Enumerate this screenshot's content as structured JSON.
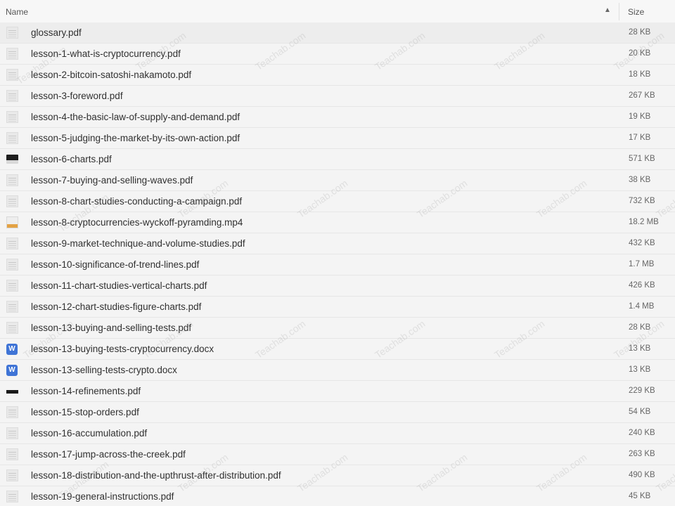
{
  "header": {
    "name_label": "Name",
    "sort_icon": "▲",
    "size_label": "Size"
  },
  "files": [
    {
      "name": "glossary.pdf",
      "size": "28 KB",
      "icon": "doc-thumb"
    },
    {
      "name": "lesson-1-what-is-cryptocurrency.pdf",
      "size": "20 KB",
      "icon": "doc-thumb"
    },
    {
      "name": "lesson-2-bitcoin-satoshi-nakamoto.pdf",
      "size": "18 KB",
      "icon": "doc-thumb"
    },
    {
      "name": "lesson-3-foreword.pdf",
      "size": "267 KB",
      "icon": "doc-thumb"
    },
    {
      "name": "lesson-4-the-basic-law-of-supply-and-demand.pdf",
      "size": "19 KB",
      "icon": "doc-thumb"
    },
    {
      "name": "lesson-5-judging-the-market-by-its-own-action.pdf",
      "size": "17 KB",
      "icon": "doc-thumb"
    },
    {
      "name": "lesson-6-charts.pdf",
      "size": "571 KB",
      "icon": "dark-thumb"
    },
    {
      "name": "lesson-7-buying-and-selling-waves.pdf",
      "size": "38 KB",
      "icon": "doc-thumb"
    },
    {
      "name": "lesson-8-chart-studies-conducting-a-campaign.pdf",
      "size": "732 KB",
      "icon": "doc-thumb"
    },
    {
      "name": "lesson-8-cryptocurrencies-wyckoff-pyramding.mp4",
      "size": "18.2 MB",
      "icon": "video-thumb"
    },
    {
      "name": "lesson-9-market-technique-and-volume-studies.pdf",
      "size": "432 KB",
      "icon": "doc-thumb"
    },
    {
      "name": "lesson-10-significance-of-trend-lines.pdf",
      "size": "1.7 MB",
      "icon": "doc-thumb"
    },
    {
      "name": "lesson-11-chart-studies-vertical-charts.pdf",
      "size": "426 KB",
      "icon": "doc-thumb"
    },
    {
      "name": "lesson-12-chart-studies-figure-charts.pdf",
      "size": "1.4 MB",
      "icon": "doc-thumb"
    },
    {
      "name": "lesson-13-buying-and-selling-tests.pdf",
      "size": "28 KB",
      "icon": "doc-thumb"
    },
    {
      "name": "lesson-13-buying-tests-cryptocurrency.docx",
      "size": "13 KB",
      "icon": "word-icon"
    },
    {
      "name": "lesson-13-selling-tests-crypto.docx",
      "size": "13 KB",
      "icon": "word-icon"
    },
    {
      "name": "lesson-14-refinements.pdf",
      "size": "229 KB",
      "icon": "bar-thumb"
    },
    {
      "name": "lesson-15-stop-orders.pdf",
      "size": "54 KB",
      "icon": "doc-thumb"
    },
    {
      "name": "lesson-16-accumulation.pdf",
      "size": "240 KB",
      "icon": "doc-thumb"
    },
    {
      "name": "lesson-17-jump-across-the-creek.pdf",
      "size": "263 KB",
      "icon": "doc-thumb"
    },
    {
      "name": "lesson-18-distribution-and-the-upthrust-after-distribution.pdf",
      "size": "490 KB",
      "icon": "doc-thumb"
    },
    {
      "name": "lesson-19-general-instructions.pdf",
      "size": "45 KB",
      "icon": "doc-thumb"
    }
  ],
  "word_icon_letter": "W",
  "watermark_text": "Teachab.com",
  "colors": {
    "word_blue": "#3f74d6",
    "video_orange": "#e3a244",
    "row_border": "#e6e6e6"
  }
}
